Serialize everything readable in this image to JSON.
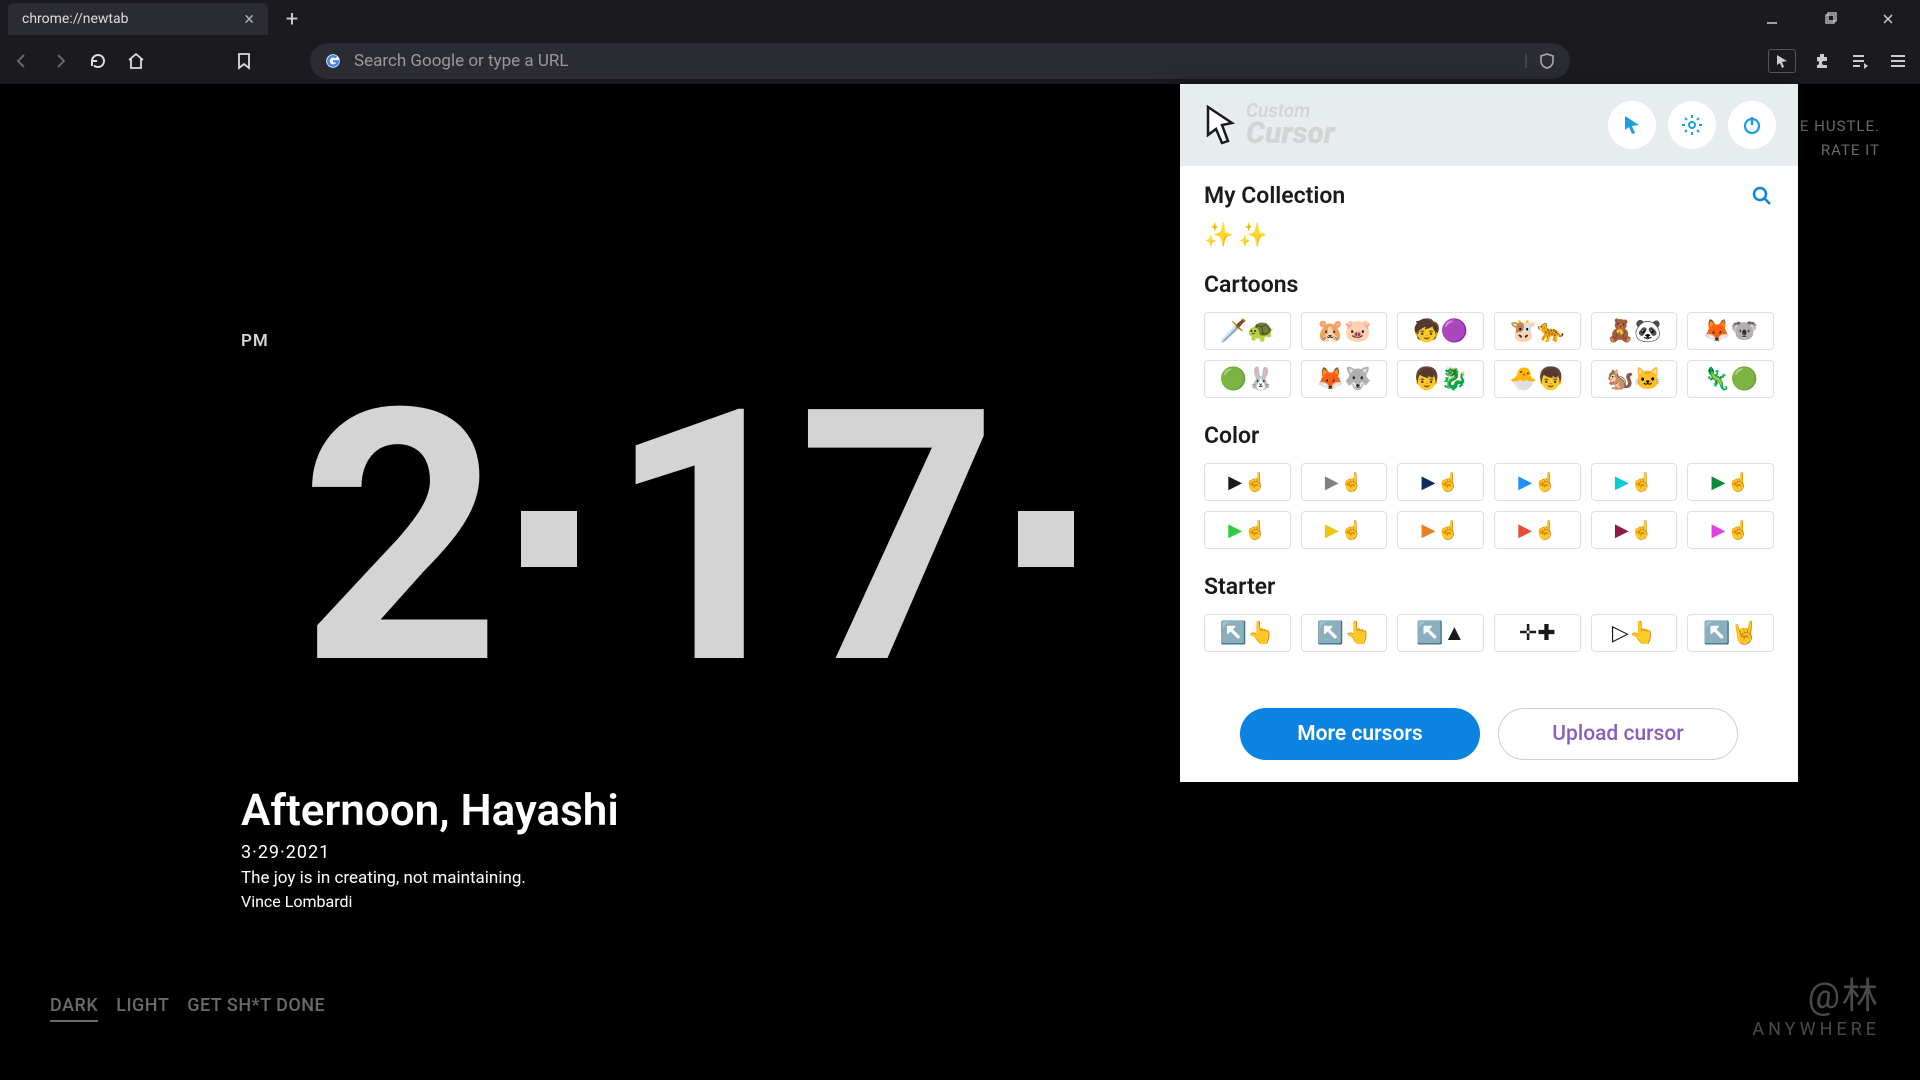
{
  "browser": {
    "tab_title": "chrome://newtab",
    "address_placeholder": "Search Google or type a URL",
    "icons": {
      "back": "back-icon",
      "forward": "forward-icon",
      "reload": "reload-icon",
      "home": "home-icon",
      "bookmark": "bookmark-icon",
      "shield": "shield-icon",
      "cursor_ext": "cursor-ext-icon",
      "extensions": "puzzle-icon",
      "readlist": "readlist-icon",
      "menu": "hamburger-icon",
      "min": "minimize-icon",
      "max": "maximize-icon",
      "close": "window-close-icon"
    }
  },
  "newtab": {
    "meridian": "PM",
    "hour": "2",
    "minute": "17",
    "greeting": "Afternoon, Hayashi",
    "date": "3·29·2021",
    "quote": "The joy is in creating, not maintaining.",
    "author": "Vince Lombardi",
    "themes": [
      "DARK",
      "LIGHT",
      "GET SH*T DONE"
    ],
    "active_theme_index": 0,
    "top_right_line1": "SAME HUSTLE.",
    "top_right_line2": "RATE IT",
    "watermark_line1": "@林",
    "watermark_line2": "ANYWHERE"
  },
  "extension": {
    "brand_line1": "Custom",
    "brand_line2": "Cursor",
    "header_buttons": [
      "active-cursor",
      "settings",
      "power"
    ],
    "my_collection_title": "My Collection",
    "my_collection_items": [
      "✨",
      "✨"
    ],
    "sections": [
      {
        "title": "Cartoons",
        "items": [
          "🗡️🐢",
          "🐹🐷",
          "🧒🟣",
          "🐮🐆",
          "🧸🐼",
          "🦊🐨",
          "🟢🐰",
          "🦊🐺",
          "👦🐉",
          "🐣👦",
          "🐿️🐱",
          "🦎🟢"
        ]
      },
      {
        "title": "Color",
        "colors": [
          "#1a1a1a",
          "#808080",
          "#0b2d5e",
          "#1e90ff",
          "#00ced1",
          "#0a8a3a",
          "#2ecc40",
          "#f1c40f",
          "#e67e22",
          "#e74c3c",
          "#8e1b46",
          "#e040e0"
        ]
      },
      {
        "title": "Starter",
        "items": [
          "↖️👆",
          "↖️👆",
          "↖️▲",
          "✛✚",
          "▷👆",
          "↖️🤘"
        ]
      }
    ],
    "more_btn": "More cursors",
    "upload_btn": "Upload cursor"
  }
}
